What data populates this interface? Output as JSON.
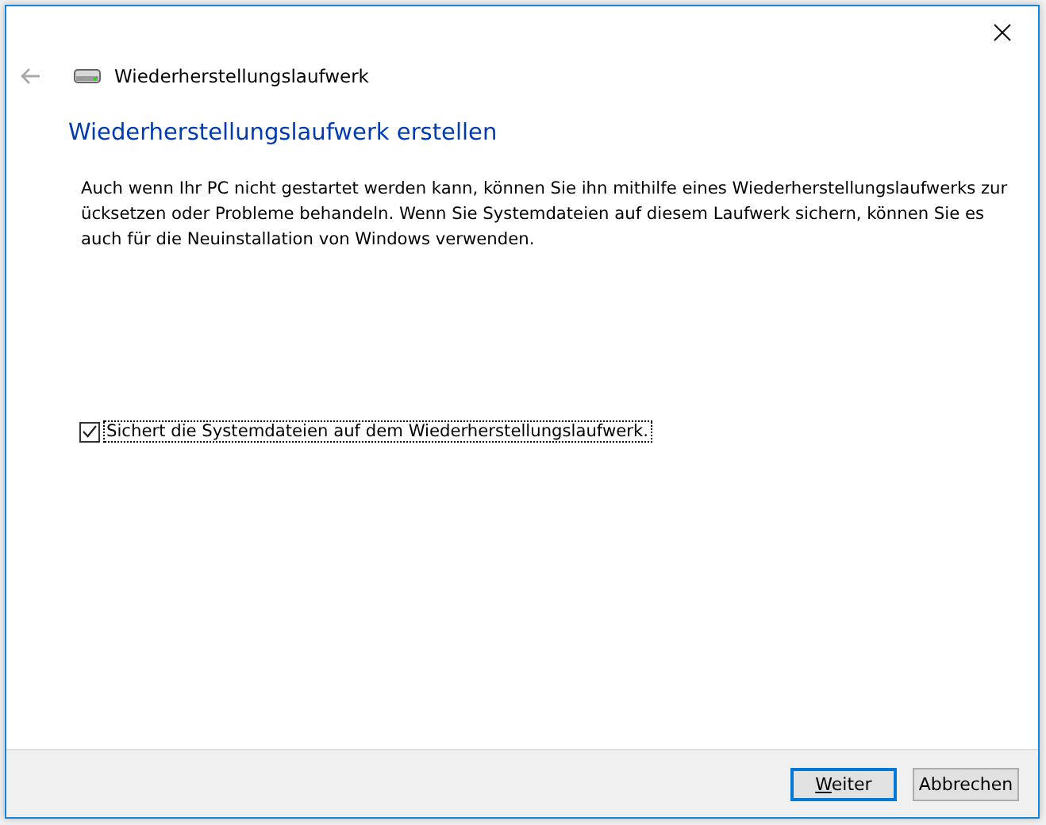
{
  "window": {
    "title": "Wiederherstellungslaufwerk"
  },
  "heading": "Wiederherstellungslaufwerk erstellen",
  "description_lines": [
    "Auch wenn Ihr PC nicht gestartet werden kann, können Sie ihn mithilfe eines Wiederherstellungslaufwerks zur",
    "ücksetzen oder Probleme behandeln. Wenn Sie Systemdateien auf diesem Laufwerk sichern, können Sie es",
    "auch für die Neuinstallation von Windows verwenden."
  ],
  "checkbox": {
    "label": "Sichert die Systemdateien auf dem Wiederherstellungslaufwerk.",
    "checked": true,
    "focused": true
  },
  "buttons": [
    {
      "label": "Weiter",
      "default": true,
      "mnemonic_underlined": true
    },
    {
      "label": "Abbrechen",
      "default": false,
      "mnemonic_underlined": false
    }
  ]
}
